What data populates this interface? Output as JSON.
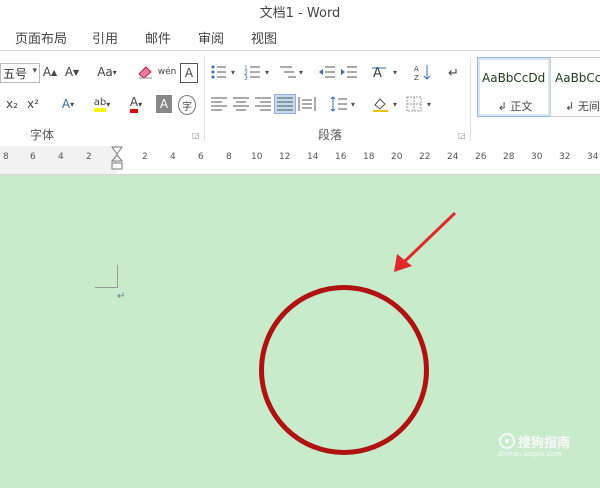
{
  "window": {
    "title": "文档1 - Word"
  },
  "tabs": [
    "页面布局",
    "引用",
    "邮件",
    "审阅",
    "视图"
  ],
  "font_group": {
    "label": "字体",
    "size_value": "五号",
    "buttons": [
      "A",
      "A",
      "Aa",
      "wén",
      "A",
      "x₂",
      "x²",
      "A",
      "ab",
      "A",
      "A",
      "字"
    ]
  },
  "para_group": {
    "label": "段落"
  },
  "styles": [
    {
      "sample": "AaBbCcDd",
      "name": "↲ 正文"
    },
    {
      "sample": "AaBbCcDd",
      "name": "↲ 无间隔"
    }
  ],
  "ruler": {
    "left_ticks": [
      "8",
      "6",
      "4",
      "2"
    ],
    "right_ticks": [
      "2",
      "4",
      "6",
      "8",
      "10",
      "12",
      "14",
      "16",
      "18",
      "20",
      "22",
      "24",
      "26",
      "28",
      "30",
      "32",
      "34"
    ]
  },
  "document": {
    "paragraph_mark": "↵"
  },
  "annotations": {
    "circle_color": "#b01111",
    "arrow_color": "#e02a2a"
  },
  "watermark": {
    "text": "搜狗指南",
    "sub": "zhinan.sogou.com"
  }
}
